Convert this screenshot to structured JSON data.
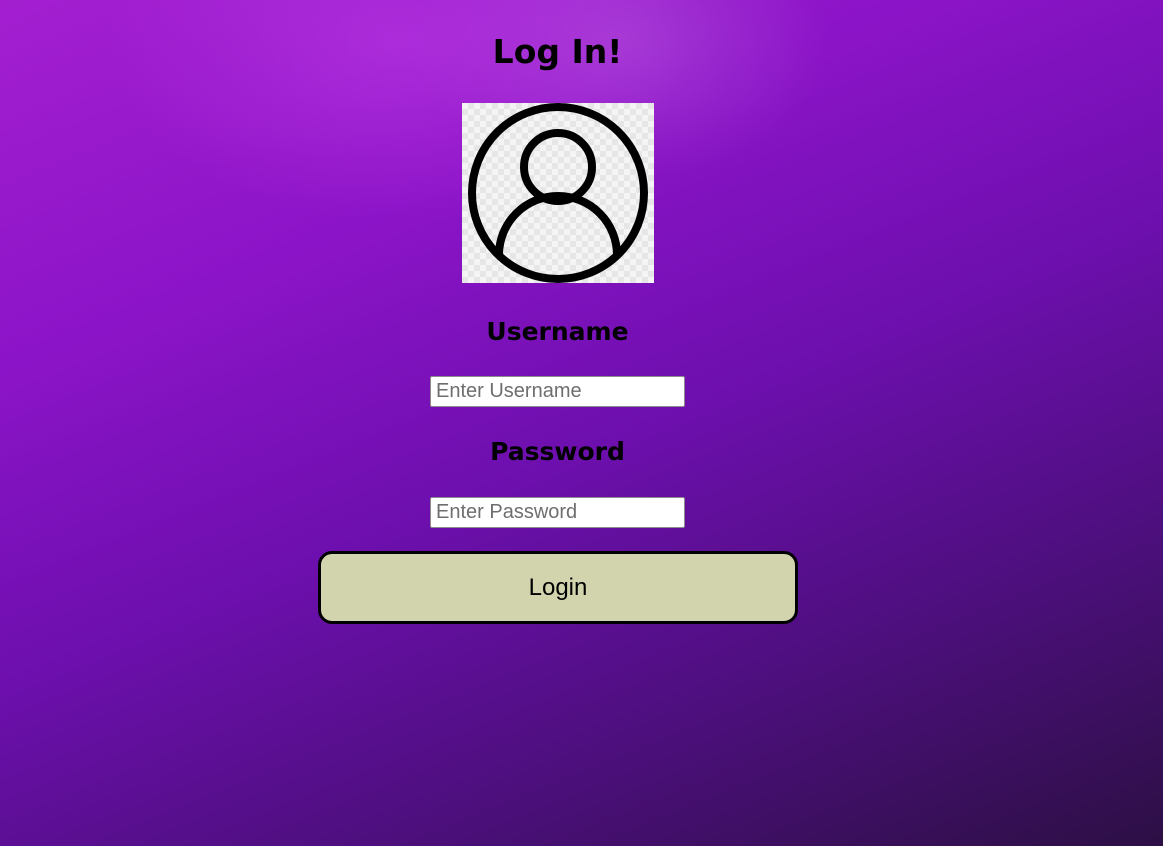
{
  "page": {
    "title": "Log In!"
  },
  "avatar": {
    "icon": "user-circle-icon"
  },
  "username": {
    "label": "Username",
    "placeholder": "Enter Username",
    "value": ""
  },
  "password": {
    "label": "Password",
    "placeholder": "Enter Password",
    "value": ""
  },
  "login_button": {
    "label": "Login"
  },
  "colors": {
    "background_top": "#a31fd0",
    "background_bottom": "#2c0f44",
    "button_fill": "#d2d4ae",
    "text": "#000000"
  }
}
